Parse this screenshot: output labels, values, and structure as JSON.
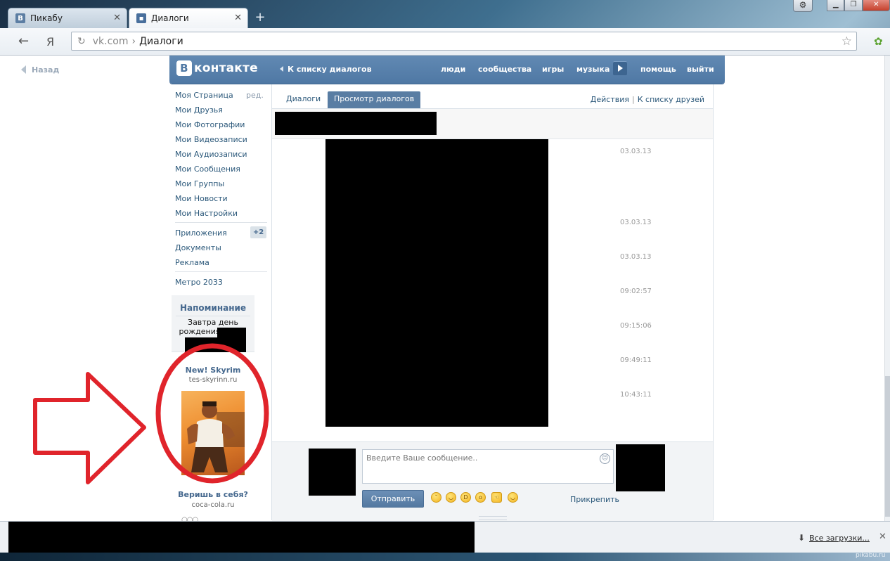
{
  "browser": {
    "tabs": [
      {
        "label": "Пикабу",
        "active": false,
        "favicon": "B"
      },
      {
        "label": "Диалоги",
        "active": true,
        "favicon": "dialog-icon"
      }
    ],
    "new_tab_symbol": "+",
    "address": {
      "host": "vk.com",
      "separator": "›",
      "title": "Диалоги"
    },
    "yandex_button": "Я"
  },
  "page": {
    "back_link": "Назад"
  },
  "header": {
    "logo_letter": "B",
    "logo_text": "контакте",
    "back_to_list": "К списку диалогов",
    "nav": [
      "люди",
      "сообщества",
      "игры",
      "музыка",
      "помощь",
      "выйти"
    ]
  },
  "left_menu": {
    "edit_label": "ред.",
    "items": [
      "Моя Страница",
      "Мои Друзья",
      "Мои Фотографии",
      "Мои Видеозаписи",
      "Мои Аудиозаписи",
      "Мои Сообщения",
      "Мои Группы",
      "Мои Новости",
      "Мои Настройки"
    ],
    "secondary": [
      "Приложения",
      "Документы",
      "Реклама"
    ],
    "apps_badge": "+2",
    "app": "Метро 2033"
  },
  "reminder": {
    "title": "Напоминание",
    "text_line1": "Завтра день",
    "text_line2": "рождения"
  },
  "ads": [
    {
      "title": "New! Skyrim",
      "domain": "tes-skyrinn.ru"
    },
    {
      "title": "Веришь в себя?",
      "domain": "coca-cola.ru"
    }
  ],
  "dialog_tabs": {
    "tab1": "Диалоги",
    "tab2": "Просмотр диалогов",
    "actions": "Действия",
    "divider": "|",
    "friends": "К списку друзей"
  },
  "messages": {
    "times": [
      "03.03.13",
      "03.03.13",
      "03.03.13",
      "09:02:57",
      "09:15:06",
      "09:49:11",
      "10:43:11"
    ]
  },
  "compose": {
    "placeholder": "Введите Ваше сообщение..",
    "send": "Отправить",
    "attach": "Прикрепить"
  },
  "downloads": {
    "all": "Все загрузки...",
    "close": "✕"
  },
  "watermark": "pikabu.ru",
  "colors": {
    "vk_blue": "#597da3",
    "link": "#2b587a",
    "annotation_red": "#e0242b"
  }
}
